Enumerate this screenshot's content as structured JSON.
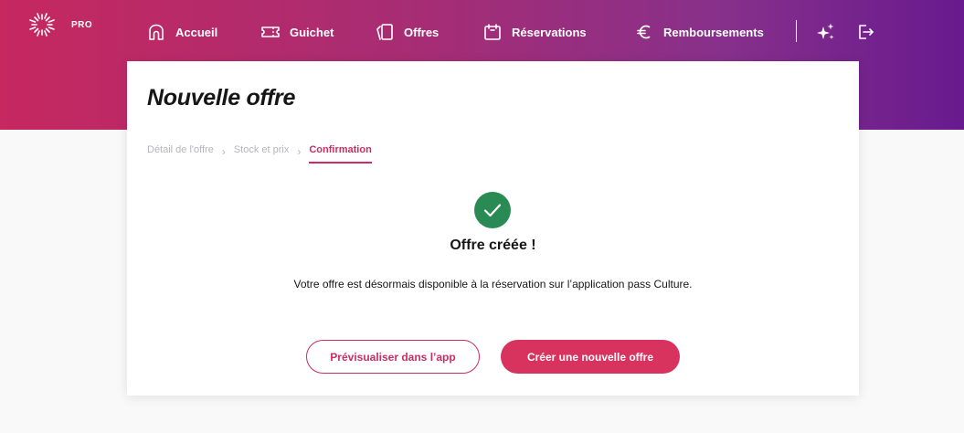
{
  "header": {
    "logo_label": "PRO",
    "nav": [
      {
        "label": "Accueil",
        "icon": "home-icon"
      },
      {
        "label": "Guichet",
        "icon": "ticket-icon"
      },
      {
        "label": "Offres",
        "icon": "offers-icon"
      },
      {
        "label": "Réservations",
        "icon": "calendar-icon"
      },
      {
        "label": "Remboursements",
        "icon": "euro-icon"
      }
    ],
    "actions": [
      {
        "icon": "sparkles-icon"
      },
      {
        "icon": "logout-icon"
      }
    ]
  },
  "main": {
    "title": "Nouvelle offre",
    "breadcrumb": [
      {
        "label": "Détail de l'offre",
        "active": false
      },
      {
        "label": "Stock et prix",
        "active": false
      },
      {
        "label": "Confirmation",
        "active": true
      }
    ],
    "confirmation": {
      "icon": "check-circle-icon",
      "title": "Offre créée !",
      "message": "Votre offre est désormais disponible à la réservation sur l’application pass Culture."
    },
    "buttons": {
      "preview_label": "Prévisualiser dans l’app",
      "create_new_label": "Créer une nouvelle offre"
    }
  },
  "colors": {
    "brand_primary": "#d8325e",
    "brand_secondary": "#cc2d61",
    "header_gradient_start": "#c6285f",
    "header_gradient_end": "#681a8e",
    "success": "#2a8a54"
  }
}
